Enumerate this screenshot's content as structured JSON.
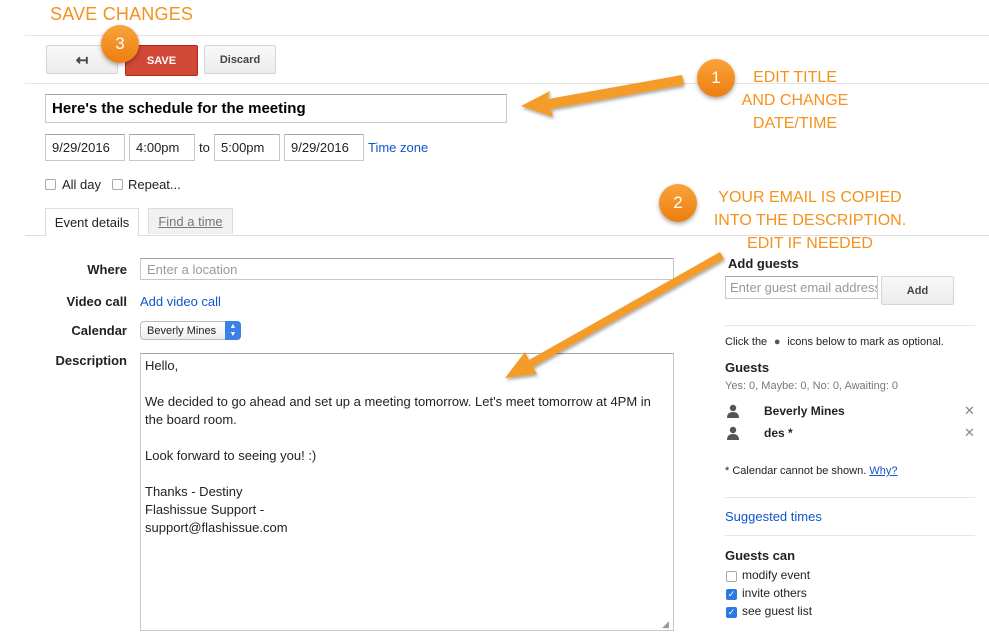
{
  "annotations": {
    "save_changes": "SAVE CHANGES",
    "step1_num": "1",
    "step1_lines": [
      "EDIT TITLE",
      "AND CHANGE",
      "DATE/TIME"
    ],
    "step2_num": "2",
    "step2_lines": [
      "YOUR EMAIL IS COPIED",
      "INTO THE DESCRIPTION.",
      "EDIT IF NEEDED"
    ],
    "step3_num": "3",
    "color": "#f4921c"
  },
  "toolbar": {
    "back_icon": "back-arrow-icon",
    "back_glyph": "↤",
    "save_label": "SAVE",
    "discard_label": "Discard"
  },
  "event": {
    "title": "Here's the schedule for the meeting",
    "start_date": "9/29/2016",
    "start_time": "4:00pm",
    "to_label": "to",
    "end_time": "5:00pm",
    "end_date": "9/29/2016",
    "time_zone_link": "Time zone",
    "all_day_label": "All day",
    "repeat_label": "Repeat..."
  },
  "tabs": {
    "event_details": "Event details",
    "find_a_time": "Find a time"
  },
  "details": {
    "where_label": "Where",
    "where_placeholder": "Enter a location",
    "video_label": "Video call",
    "video_link": "Add video call",
    "calendar_label": "Calendar",
    "calendar_value": "Beverly Mines",
    "description_label": "Description",
    "description_lines": [
      "Hello,",
      "We decided to go ahead and set up a meeting tomorrow. Let's meet tomorrow at 4PM in",
      "the board room.",
      "Look forward to seeing you! :)",
      "Thanks - Destiny",
      "Flashissue Support -",
      "support@flashissue.com"
    ]
  },
  "guests_panel": {
    "add_guests_title": "Add guests",
    "guest_input_placeholder": "Enter guest email address",
    "add_button": "Add",
    "click_hint_pre": "Click the",
    "click_hint_post": "icons below to mark as optional.",
    "guests_title": "Guests",
    "guests_summary": "Yes: 0, Maybe: 0, No: 0, Awaiting: 0",
    "guests": [
      {
        "name": "Beverly Mines"
      },
      {
        "name": "des *"
      }
    ],
    "calendar_note": "* Calendar cannot be shown.",
    "why_link": "Why?",
    "suggested_times": "Suggested times",
    "guests_can_title": "Guests can",
    "permissions": [
      {
        "label": "modify event",
        "checked": false
      },
      {
        "label": "invite others",
        "checked": true
      },
      {
        "label": "see guest list",
        "checked": true
      }
    ]
  }
}
